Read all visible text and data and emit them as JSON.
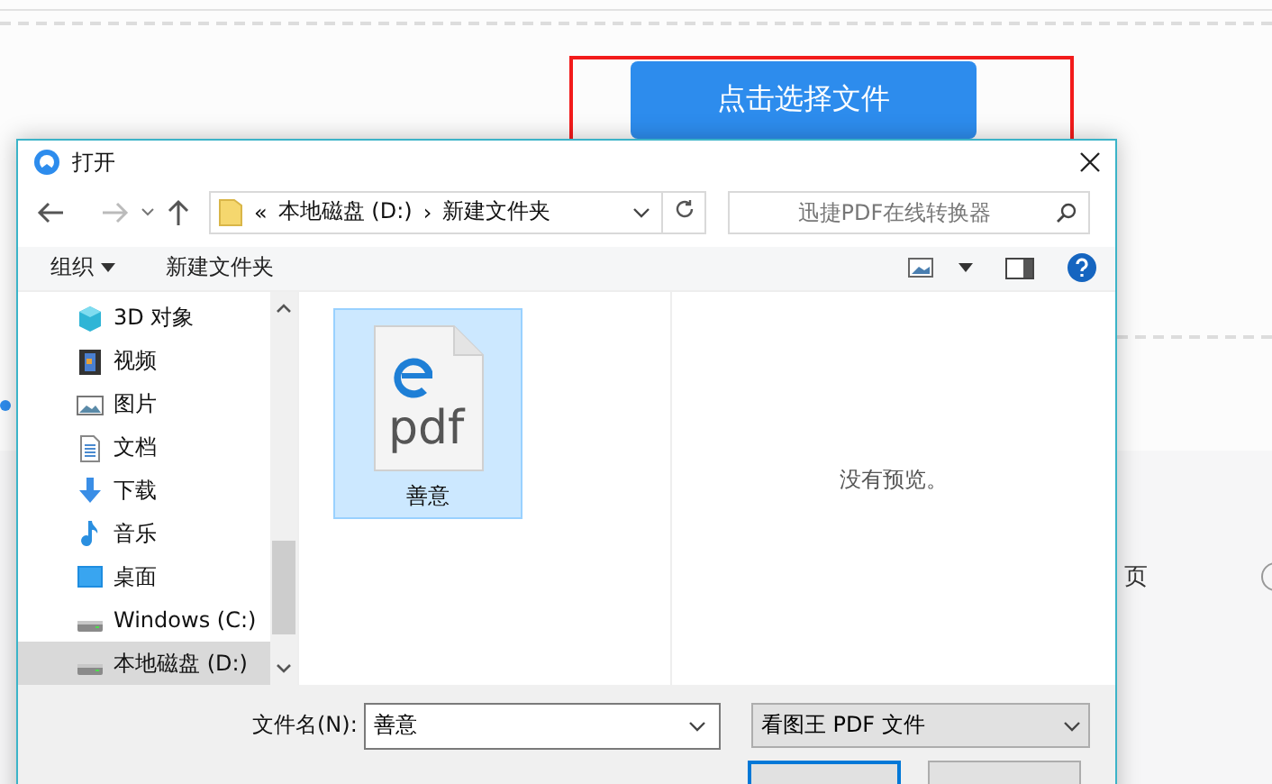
{
  "page": {
    "upload_button": "点击选择文件",
    "side_text": "页"
  },
  "dialog": {
    "title": "打开",
    "address": {
      "prefix": "«",
      "separator": "›",
      "segments": [
        "本地磁盘 (D:)",
        "新建文件夹"
      ]
    },
    "search": {
      "placeholder": "迅捷PDF在线转换器"
    },
    "toolbar": {
      "organize": "组织",
      "new_folder": "新建文件夹"
    },
    "nav_items": [
      {
        "label": "3D 对象",
        "kind": "cube",
        "selected": false
      },
      {
        "label": "视频",
        "kind": "film",
        "selected": false
      },
      {
        "label": "图片",
        "kind": "image",
        "selected": false
      },
      {
        "label": "文档",
        "kind": "document",
        "selected": false
      },
      {
        "label": "下载",
        "kind": "download",
        "selected": false
      },
      {
        "label": "音乐",
        "kind": "music",
        "selected": false
      },
      {
        "label": "桌面",
        "kind": "desktop",
        "selected": false
      },
      {
        "label": "Windows (C:)",
        "kind": "drive",
        "selected": false
      },
      {
        "label": "本地磁盘 (D:)",
        "kind": "drive",
        "selected": true
      }
    ],
    "files": [
      {
        "name": "善意",
        "icon_text": "pdf",
        "selected": true
      }
    ],
    "preview": "没有预览。",
    "filename": {
      "label": "文件名(N):",
      "value": "善意"
    },
    "filetype": "看图王 PDF 文件"
  }
}
